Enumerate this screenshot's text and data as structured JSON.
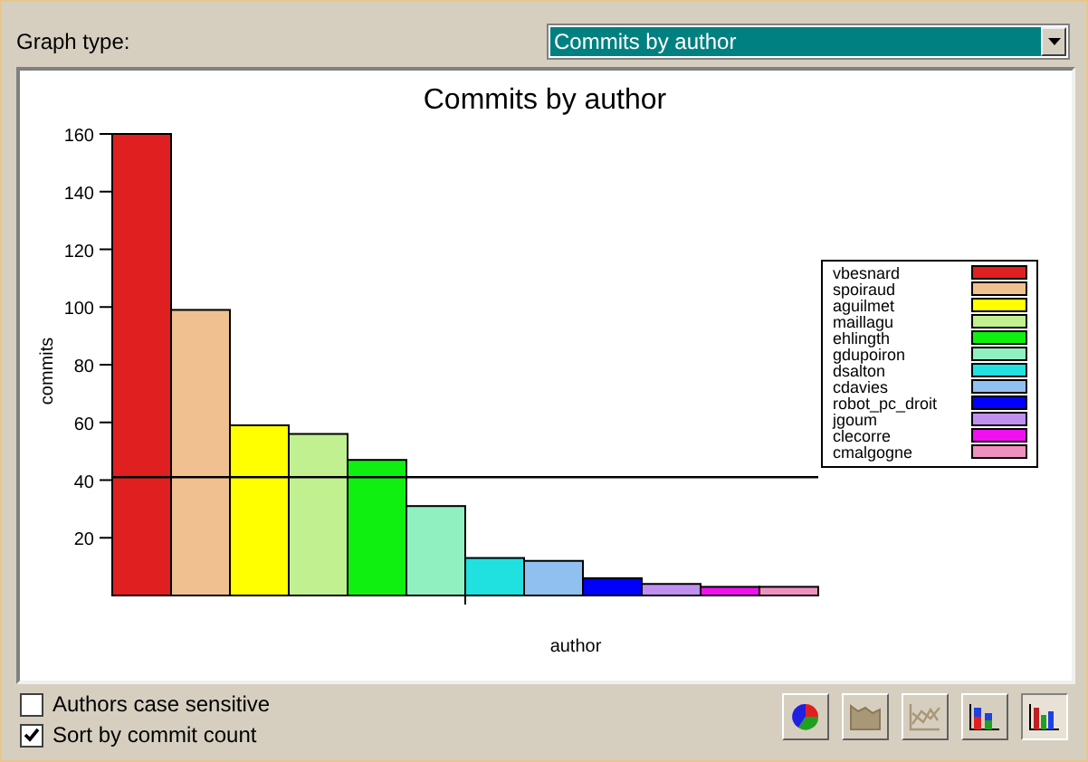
{
  "graph_type": {
    "label": "Graph type:",
    "value": "Commits by author"
  },
  "chart": {
    "chart_data": {
      "type": "bar",
      "title": "Commits by author",
      "xlabel": "author",
      "ylabel": "commits",
      "series": [
        {
          "name": "vbesnard",
          "color": "#e02020",
          "values": [
            160
          ]
        },
        {
          "name": "spoiraud",
          "color": "#f0c090",
          "values": [
            99
          ]
        },
        {
          "name": "aguilmet",
          "color": "#ffff00",
          "values": [
            59
          ]
        },
        {
          "name": "maillagu",
          "color": "#c0f090",
          "values": [
            56
          ]
        },
        {
          "name": "ehlingth",
          "color": "#10f010",
          "values": [
            47
          ]
        },
        {
          "name": "gdupoiron",
          "color": "#90f0c0",
          "values": [
            31
          ]
        },
        {
          "name": "dsalton",
          "color": "#20e0e0",
          "values": [
            13
          ]
        },
        {
          "name": "cdavies",
          "color": "#90c0f0",
          "values": [
            12
          ]
        },
        {
          "name": "robot_pc_droit",
          "color": "#0000ff",
          "values": [
            6
          ]
        },
        {
          "name": "jgoum",
          "color": "#c090f0",
          "values": [
            4
          ]
        },
        {
          "name": "clecorre",
          "color": "#f010f0",
          "values": [
            3
          ]
        },
        {
          "name": "cmalgogne",
          "color": "#f090c0",
          "values": [
            3
          ]
        }
      ],
      "ylim": [
        0,
        160
      ],
      "yticks": [
        20,
        40,
        60,
        80,
        100,
        120,
        140,
        160
      ],
      "ref_lines": [
        {
          "axis": "y",
          "value": 41
        }
      ]
    }
  },
  "options": [
    {
      "label": "Authors case sensitive",
      "checked": false
    },
    {
      "label": "Sort by commit count",
      "checked": true
    }
  ],
  "graph_buttons": [
    {
      "kind": "pie",
      "disabled": false,
      "selected": false
    },
    {
      "kind": "area",
      "disabled": true,
      "selected": false
    },
    {
      "kind": "line",
      "disabled": true,
      "selected": false
    },
    {
      "kind": "stacked",
      "disabled": false,
      "selected": false
    },
    {
      "kind": "bar",
      "disabled": false,
      "selected": true
    }
  ]
}
